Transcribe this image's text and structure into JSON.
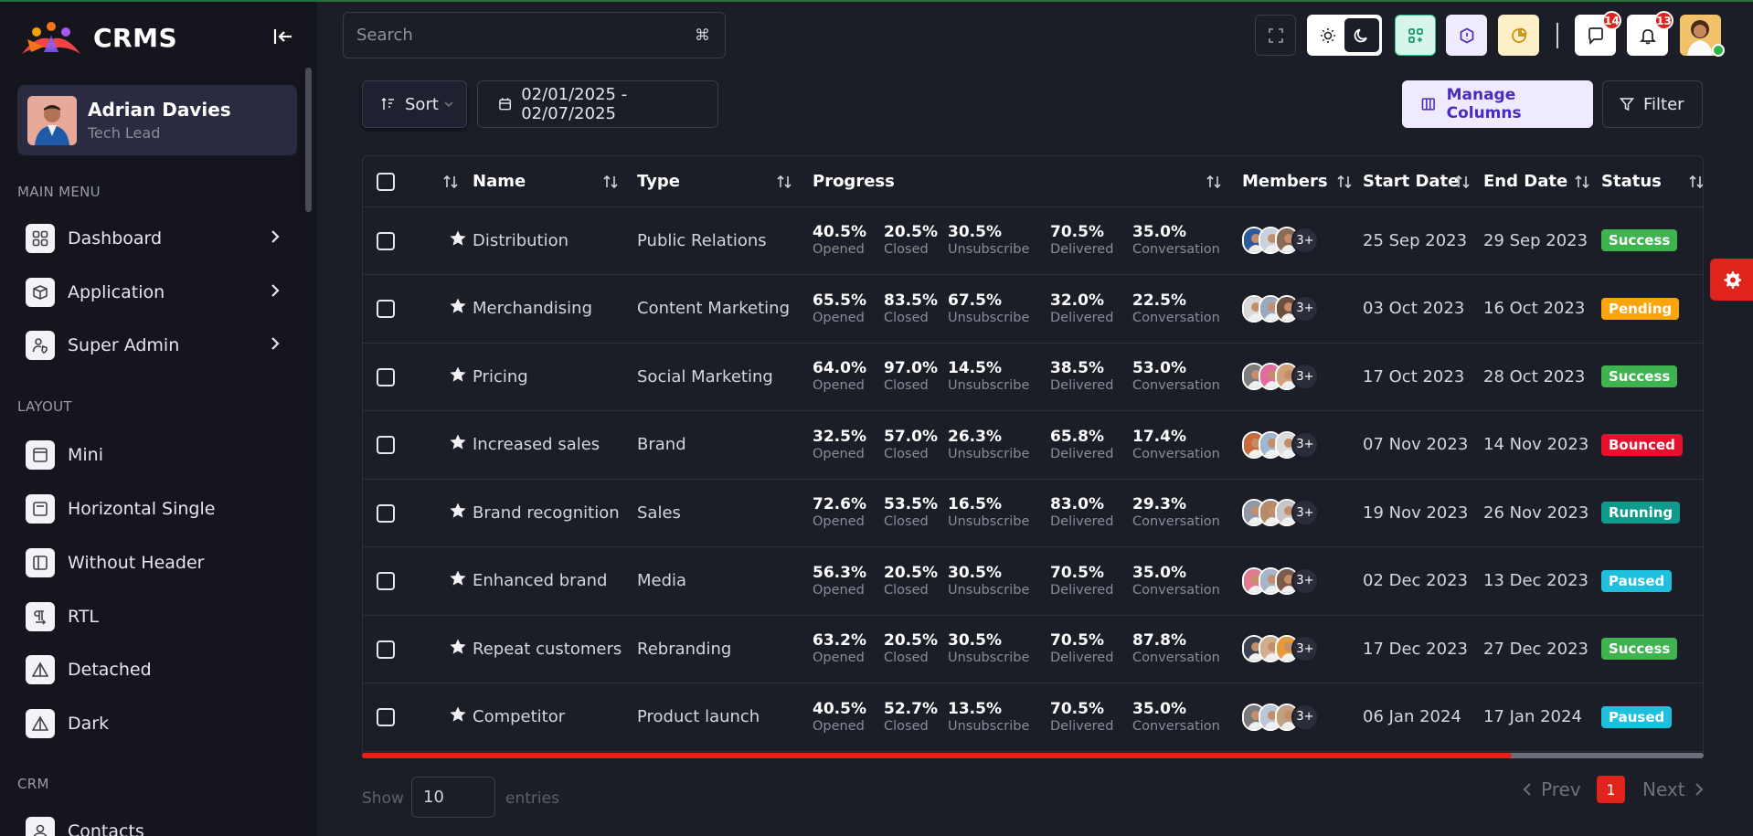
{
  "app": {
    "name": "CRMS"
  },
  "profile": {
    "name": "Adrian Davies",
    "role": "Tech Lead"
  },
  "sidebar": {
    "main_menu_title": "MAIN MENU",
    "main_menu": [
      {
        "label": "Dashboard",
        "icon": "dashboard-icon"
      },
      {
        "label": "Application",
        "icon": "box-icon"
      },
      {
        "label": "Super Admin",
        "icon": "user-shield-icon"
      }
    ],
    "layout_title": "LAYOUT",
    "layout": [
      {
        "label": "Mini",
        "icon": "layout-icon"
      },
      {
        "label": "Horizontal Single",
        "icon": "layout-icon"
      },
      {
        "label": "Without Header",
        "icon": "layout-sidebar-icon"
      },
      {
        "label": "RTL",
        "icon": "rtl-icon"
      },
      {
        "label": "Detached",
        "icon": "triangle-icon"
      },
      {
        "label": "Dark",
        "icon": "triangle-icon"
      }
    ],
    "crm_title": "CRM",
    "crm": [
      {
        "label": "Contacts",
        "icon": "user-icon"
      }
    ]
  },
  "header": {
    "search_placeholder": "Search",
    "search_kbd": "⌘",
    "message_count": "14",
    "notification_count": "13"
  },
  "toolbar": {
    "sort_label": "Sort",
    "date_range": "02/01/2025 - 02/07/2025",
    "manage_columns_label": "Manage Columns",
    "filter_label": "Filter"
  },
  "table": {
    "columns": [
      "Name",
      "Type",
      "Progress",
      "Members",
      "Start Date",
      "End Date",
      "Status"
    ],
    "progress_labels": [
      "Opened",
      "Closed",
      "Unsubscribe",
      "Delivered",
      "Conversation"
    ],
    "members_more": "3+",
    "rows": [
      {
        "name": "Distribution",
        "type": "Public Relations",
        "progress": [
          "40.5%",
          "20.5%",
          "30.5%",
          "70.5%",
          "35.0%"
        ],
        "start": "25 Sep 2023",
        "end": "29 Sep 2023",
        "status": "Success",
        "status_color": "#3fb34f"
      },
      {
        "name": "Merchandising",
        "type": "Content Marketing",
        "progress": [
          "65.5%",
          "83.5%",
          "67.5%",
          "32.0%",
          "22.5%"
        ],
        "start": "03 Oct 2023",
        "end": "16 Oct 2023",
        "status": "Pending",
        "status_color": "#f9a50b"
      },
      {
        "name": "Pricing",
        "type": "Social Marketing",
        "progress": [
          "64.0%",
          "97.0%",
          "14.5%",
          "38.5%",
          "53.0%"
        ],
        "start": "17 Oct 2023",
        "end": "28 Oct 2023",
        "status": "Success",
        "status_color": "#3fb34f"
      },
      {
        "name": "Increased sales",
        "type": "Brand",
        "progress": [
          "32.5%",
          "57.0%",
          "26.3%",
          "65.8%",
          "17.4%"
        ],
        "start": "07 Nov 2023",
        "end": "14 Nov 2023",
        "status": "Bounced",
        "status_color": "#e8102f"
      },
      {
        "name": "Brand recognition",
        "type": "Sales",
        "progress": [
          "72.6%",
          "53.5%",
          "16.5%",
          "83.0%",
          "29.3%"
        ],
        "start": "19 Nov 2023",
        "end": "26 Nov 2023",
        "status": "Running",
        "status_color": "#109a8c"
      },
      {
        "name": "Enhanced brand",
        "type": "Media",
        "progress": [
          "56.3%",
          "20.5%",
          "30.5%",
          "70.5%",
          "35.0%"
        ],
        "start": "02 Dec 2023",
        "end": "13 Dec 2023",
        "status": "Paused",
        "status_color": "#1ec0de"
      },
      {
        "name": "Repeat customers",
        "type": "Rebranding",
        "progress": [
          "63.2%",
          "20.5%",
          "30.5%",
          "70.5%",
          "87.8%"
        ],
        "start": "17 Dec 2023",
        "end": "27 Dec 2023",
        "status": "Success",
        "status_color": "#3fb34f"
      },
      {
        "name": "Competitor",
        "type": "Product launch",
        "progress": [
          "40.5%",
          "52.7%",
          "13.5%",
          "70.5%",
          "35.0%"
        ],
        "start": "06 Jan 2024",
        "end": "17 Jan 2024",
        "status": "Paused",
        "status_color": "#1ec0de"
      }
    ]
  },
  "footer": {
    "show_label": "Show",
    "entries_value": "10",
    "entries_label": "entries",
    "prev_label": "Prev",
    "next_label": "Next",
    "current_page": "1"
  },
  "colors": {
    "accent": "#e0231b",
    "sidebar_bg": "#15161d",
    "page_bg": "#1b1d27",
    "manage_bg": "#efeafe"
  }
}
